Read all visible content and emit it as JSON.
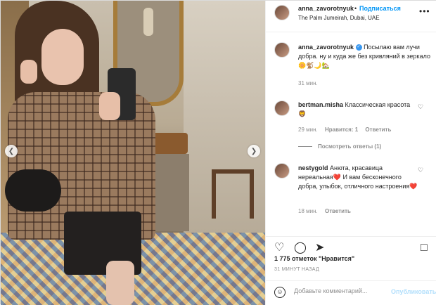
{
  "header": {
    "username": "anna_zavorotnyuk",
    "dot": "•",
    "follow_label": "Подписаться",
    "location": "The Palm Jumeirah, Dubai, UAE"
  },
  "caption": {
    "username": "anna_zavorotnyuk",
    "text": "Посылаю вам лучи добра. ну и куда же без кривляний в зеркало🌼🐒🌙🏡",
    "time": "31 мин."
  },
  "comments": [
    {
      "username": "bertman.misha",
      "text": "Классическая красота 🦁",
      "time": "29 мин.",
      "likes": "Нравится: 1",
      "reply": "Ответить",
      "view_replies": "Посмотреть ответы (1)"
    },
    {
      "username": "nestygold",
      "text": "Анюта, красавица нереальная❤️ И вам бесконечного добра, улыбок, отличного настроения❤️",
      "time": "18 мин.",
      "reply": "Ответить"
    }
  ],
  "likes_text": "1 775 отметок \"Нравится\"",
  "posted_time": "31 МИНУТ НАЗАД",
  "add_comment": {
    "placeholder": "Добавьте комментарий...",
    "publish_label": "Опубликовать"
  },
  "icons": {
    "more": "more-icon",
    "heart": "heart-icon",
    "comment": "comment-icon",
    "share": "share-icon",
    "save": "bookmark-icon",
    "emoji": "emoji-icon"
  },
  "colors": {
    "accent": "#0095f6",
    "muted": "#8e8e8e",
    "publish_disabled": "#b2dffc"
  }
}
